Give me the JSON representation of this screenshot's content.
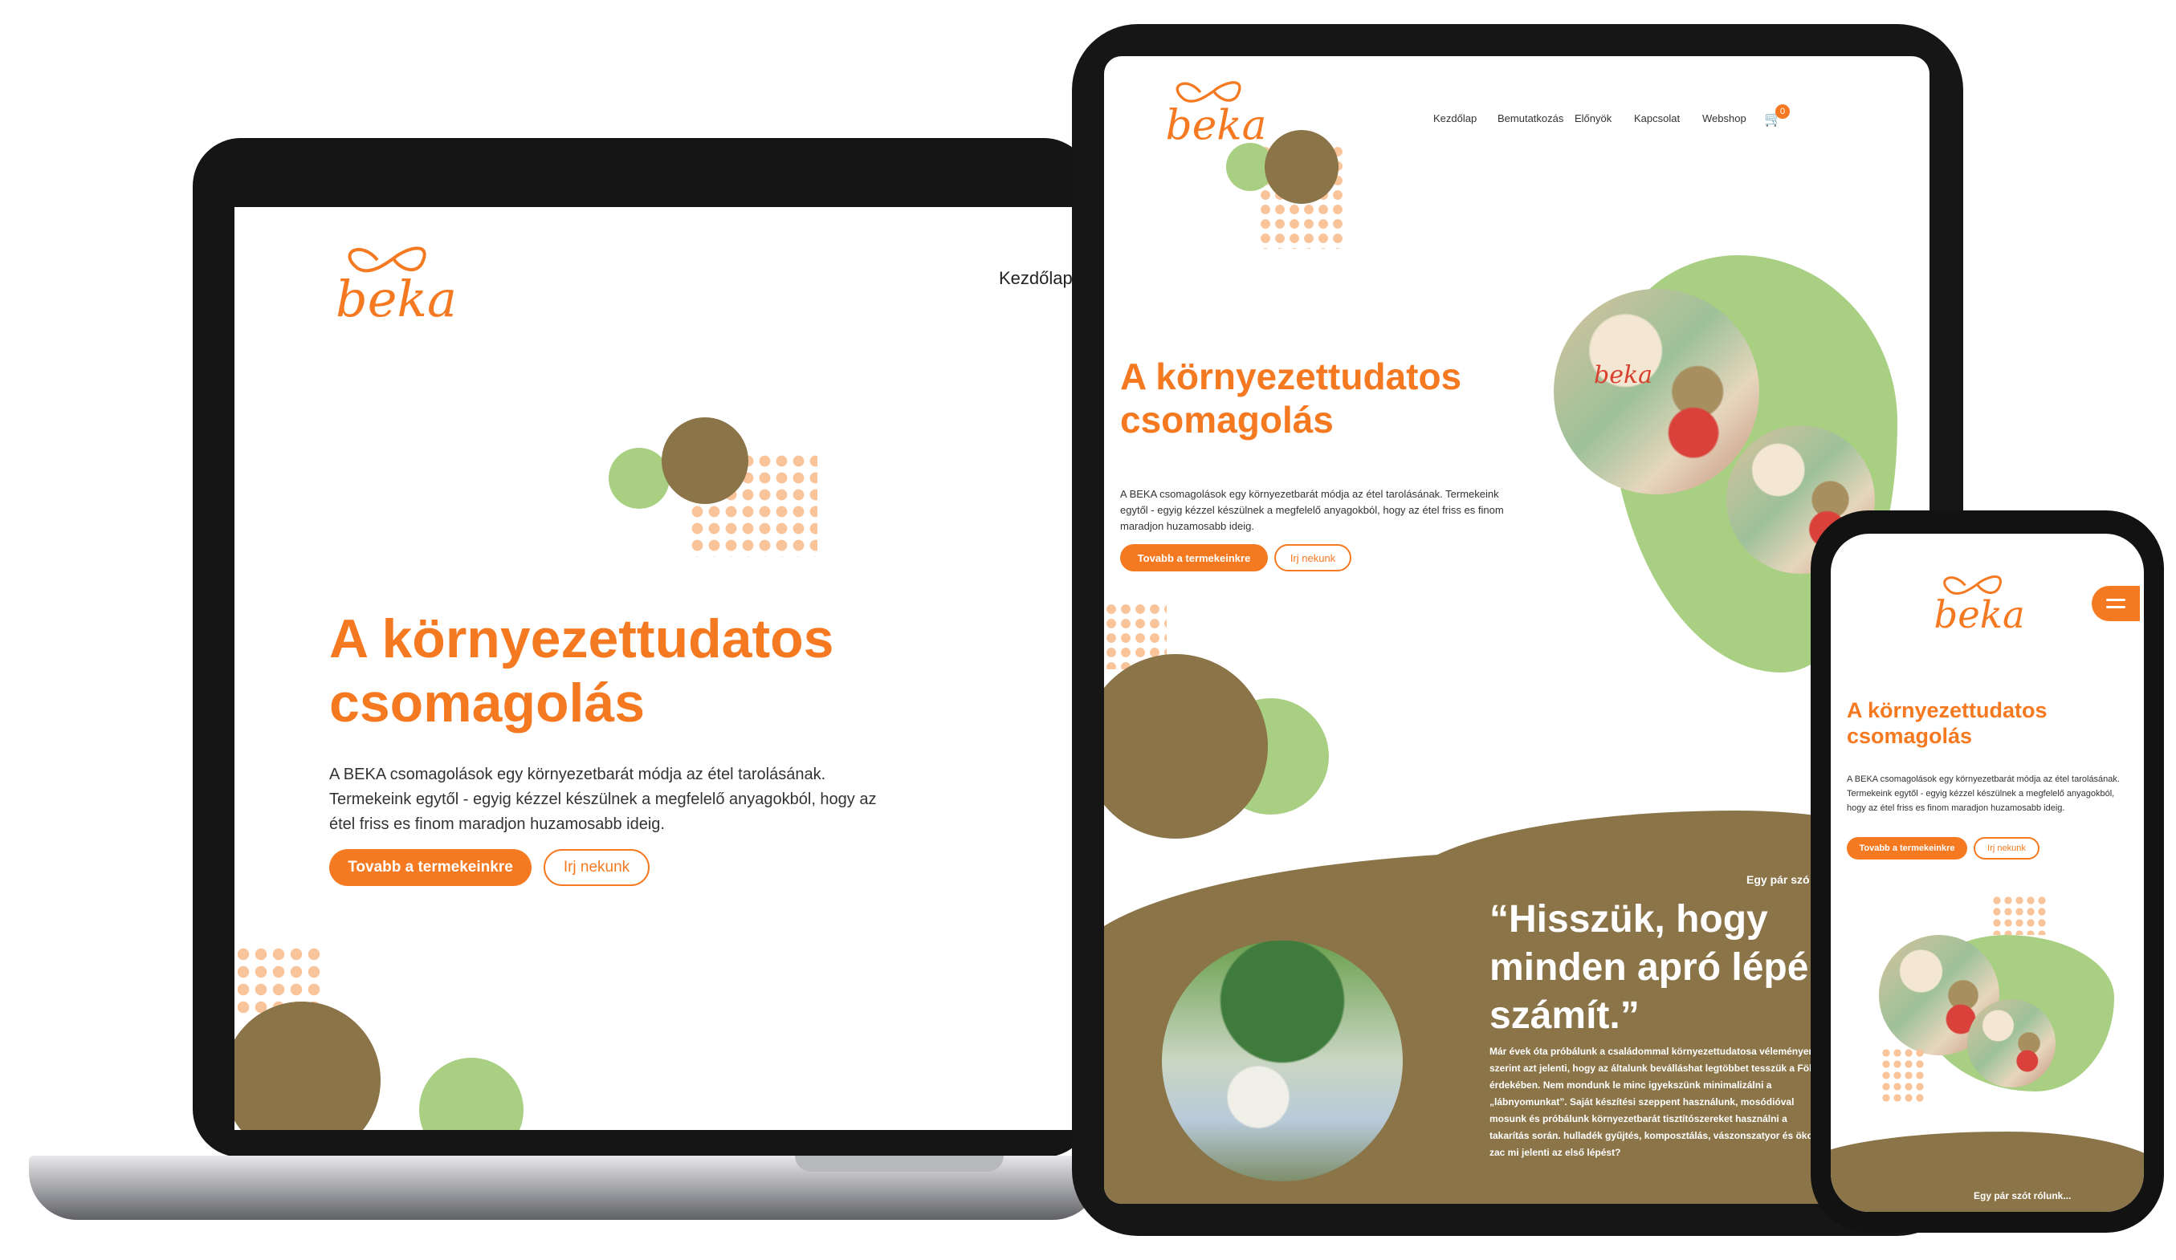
{
  "brand": {
    "logo_text": "beka",
    "orange": "#f57921",
    "brown": "#8a7448",
    "green": "#a8cf82"
  },
  "laptop": {
    "nav_item": "Kezdőlap",
    "hero_title": "A környezettudatos csomagolás",
    "hero_text": "A BEKA csomagolások egy környezetbarát módja az étel tarolásának. Termekeink egytől - egyig kézzel készülnek a megfelelő anyagokból, hogy az étel friss es finom maradjon huzamosabb ideig.",
    "btn_products": "Tovabb a termekeinkre",
    "btn_contact": "Irj nekunk"
  },
  "tablet": {
    "nav": [
      "Kezdőlap",
      "Bemutatkozás",
      "Előnyök",
      "Kapcsolat",
      "Webshop"
    ],
    "cart_count": "0",
    "hero_title": "A környezettudatos csomagolás",
    "hero_text": "A BEKA csomagolások egy környezetbarát módja az étel tarolásának. Termekeink egytől - egyig kézzel készülnek a megfelelő anyagokból, hogy az étel friss es finom maradjon huzamosabb ideig.",
    "btn_products": "Tovabb a termekeinkre",
    "btn_contact": "Irj nekunk",
    "about_label": "Egy pár szó",
    "quote": "“Hisszük, hogy minden apró lépé számít.”",
    "about_text": "Már évek óta próbálunk a családommal környezettudatosa véleményem szerint azt jelenti, hogy az általunk beválláshat legtöbbet tesszük a Föld érdekében. Nem mondunk le minc igyekszünk minimalizálni a „lábnyomunkat”. Saját készítési szeppent használunk, mosódióval mosunk és próbálunk környezetbarát tisztítószereket használni a takarítás során. hulladék gyűjtés, komposztálás, vászonszatyor és öko-zac mi jelenti az első lépést?"
  },
  "phone": {
    "hero_title": "A környezettudatos csomagolás",
    "hero_text": "A BEKA csomagolások egy környezetbarát módja az étel tarolásának. Termekeink egytől - egyig kézzel készülnek a megfelelő anyagokból, hogy az étel friss es finom maradjon huzamosabb ideig.",
    "btn_products": "Tovabb a termekeinkre",
    "btn_contact": "Irj nekunk",
    "about_label": "Egy pár szót rólunk..."
  }
}
